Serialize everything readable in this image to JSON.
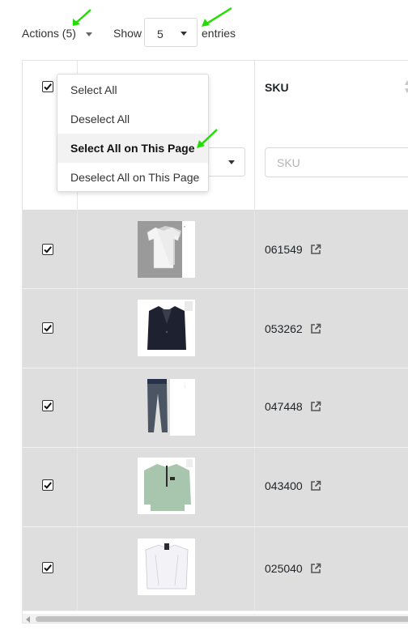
{
  "toolbar": {
    "actions_label": "Actions (5)",
    "show_label": "Show",
    "page_size": "5",
    "entries_label": "entries"
  },
  "table": {
    "columns": [
      {
        "key": "select",
        "label": ""
      },
      {
        "key": "image",
        "label": ""
      },
      {
        "key": "sku",
        "label": "SKU"
      }
    ],
    "sku_filter_placeholder": "SKU",
    "rows": [
      {
        "selected": true,
        "image": "white-tshirts",
        "sku": "061549"
      },
      {
        "selected": true,
        "image": "dark-blazer",
        "sku": "053262"
      },
      {
        "selected": true,
        "image": "grey-jeans",
        "sku": "047448"
      },
      {
        "selected": true,
        "image": "mint-sweater",
        "sku": "043400"
      },
      {
        "selected": true,
        "image": "white-shirt",
        "sku": "025040"
      }
    ]
  },
  "dropdown": {
    "items": [
      {
        "label": "Select All",
        "active": false
      },
      {
        "label": "Deselect All",
        "active": false
      },
      {
        "label": "Select All on This Page",
        "active": true
      },
      {
        "label": "Deselect All on This Page",
        "active": false
      }
    ]
  },
  "colors": {
    "row_selected_bg": "#dedede",
    "annotation_arrow": "#22dd00",
    "border": "#e6e6e6"
  },
  "icons": {
    "ext_link": "external-link-icon",
    "caret": "caret-down-icon",
    "sort": "sort-icon",
    "check": "checkbox-checked-icon"
  }
}
